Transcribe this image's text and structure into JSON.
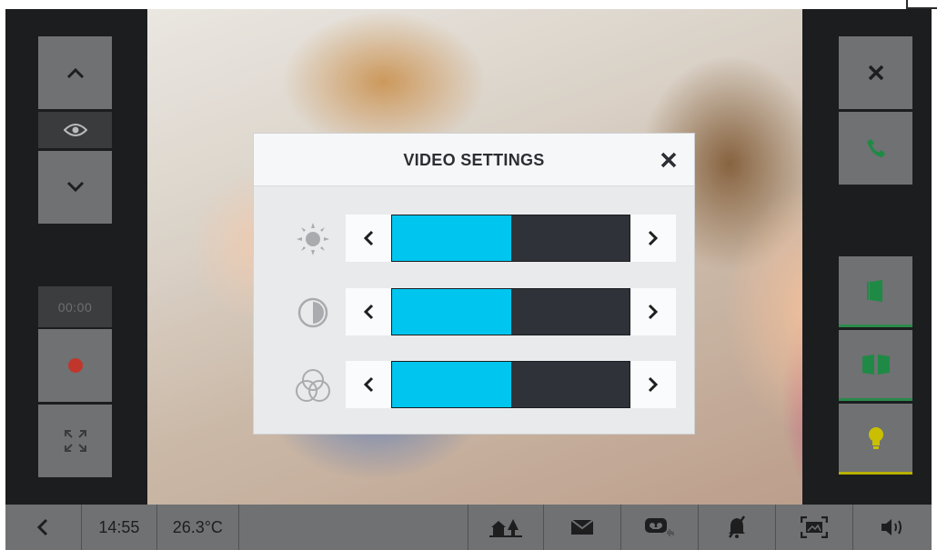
{
  "left_panel": {
    "timer": "00:00"
  },
  "dialog": {
    "title": "VIDEO SETTINGS",
    "rows": [
      {
        "setting": "brightness",
        "level": 0.5
      },
      {
        "setting": "contrast",
        "level": 0.5
      },
      {
        "setting": "color",
        "level": 0.5
      }
    ]
  },
  "bottom_bar": {
    "time": "14:55",
    "temperature": "26.3°C"
  },
  "colors": {
    "accent": "#00c6ef",
    "panel": "#6f7173",
    "call_green": "#1f8a45",
    "record_red": "#c0362c",
    "light_yellow": "#c9bf00"
  }
}
